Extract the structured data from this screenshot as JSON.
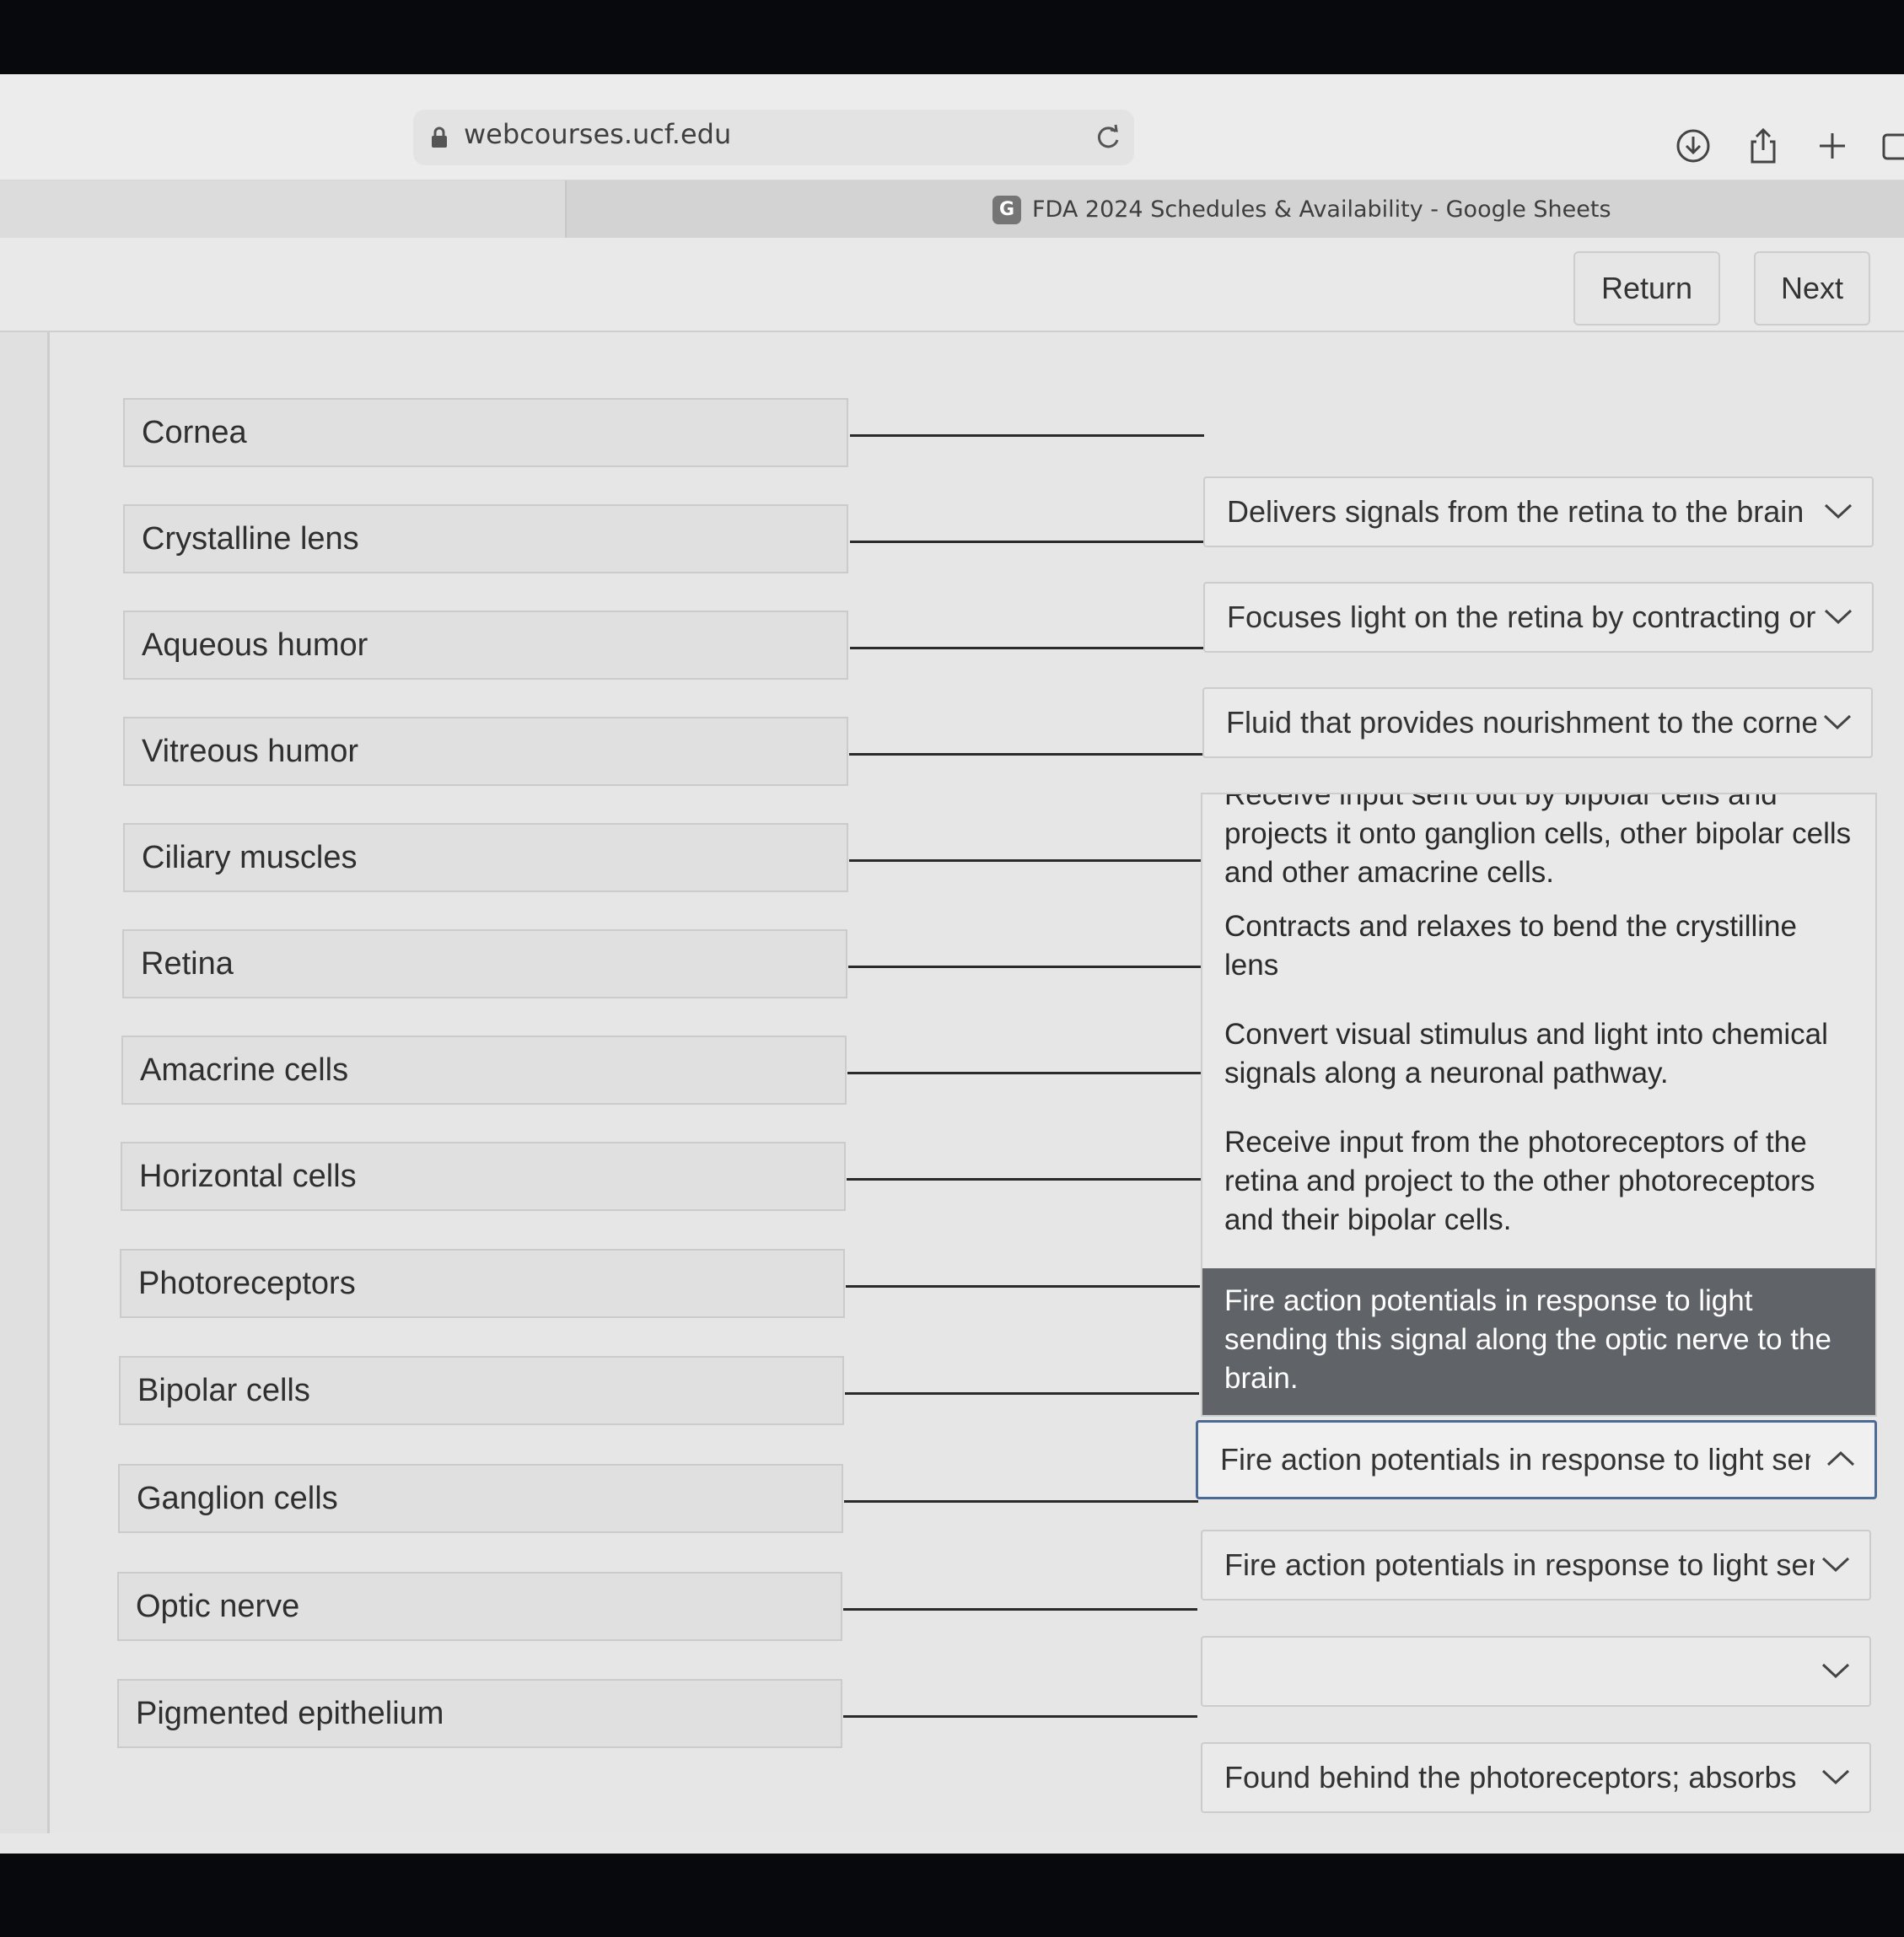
{
  "browser": {
    "url": "webcourses.ucf.edu",
    "tab_title": "FDA 2024 Schedules & Availability - Google Sheets",
    "tab_favicon": "G"
  },
  "nav": {
    "return_label": "Return",
    "next_label": "Next"
  },
  "terms": [
    "Cornea",
    "Crystalline lens",
    "Aqueous humor",
    "Vitreous humor",
    "Ciliary muscles",
    "Retina",
    "Amacrine cells",
    "Horizontal cells",
    "Photoreceptors",
    "Bipolar cells",
    "Ganglion cells",
    "Optic nerve",
    "Pigmented epithelium"
  ],
  "answers": {
    "cornea": "Delivers signals from the retina to the brain",
    "crystalline_lens": "Focuses light on the retina by contracting or relaxing",
    "aqueous_humor": "Fluid that provides nourishment to the cornea",
    "bipolar_cells": "Fire action potentials in response to light sending this signal along the optic nerve to the brain.",
    "ganglion_cells": "Fire action potentials in response to light sending this signal along the optic nerve to the brain.",
    "optic_nerve": "",
    "pigmented_epithelium": "Found behind the photoreceptors; absorbs"
  },
  "menu_options": [
    "Receive input sent out by bipolar cells and projects it onto ganglion cells, other bipolar cells and other amacrine cells.",
    "Contracts and relaxes to bend the crystilline lens",
    "Convert visual stimulus and light into chemical signals along a neuronal pathway.",
    "Receive input from the photoreceptors of the retina and project to the other photoreceptors and their bipolar cells.",
    "Fire action potentials in response to light sending this signal along the optic nerve to the brain."
  ],
  "selected_option_index": 4,
  "colors": {
    "selected_bg": "#606468",
    "focus_border": "#4b6a96"
  }
}
